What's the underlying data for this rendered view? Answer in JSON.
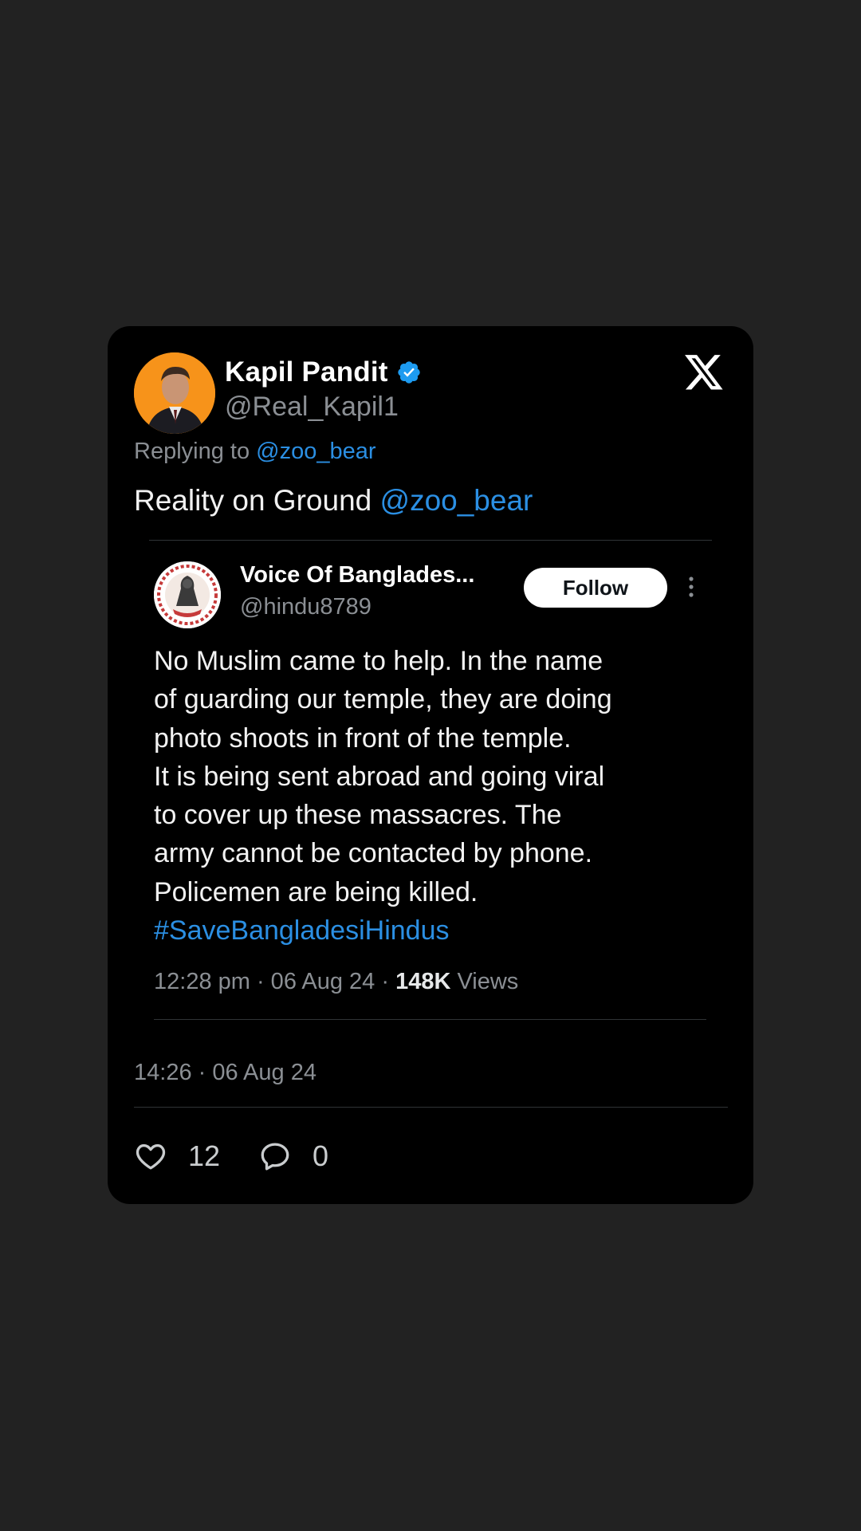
{
  "tweet": {
    "author": {
      "name": "Kapil Pandit",
      "handle": "@Real_Kapil1",
      "verified": true,
      "verified_color": "#1d9bf0",
      "avatar_bg": "#f7931a"
    },
    "platform_logo": "x-logo",
    "replying_to_prefix": "Replying to",
    "replying_to_handle": "@zoo_bear",
    "text_main": "Reality on Ground",
    "text_mention": "@zoo_bear",
    "timestamp": "14:26 · 06 Aug 24",
    "likes": "12",
    "replies": "0"
  },
  "quoted": {
    "name": "Voice Of Banglades...",
    "handle": "@hindu8789",
    "follow_label": "Follow",
    "body_lines": [
      "No Muslim came to help. In the name",
      "of guarding our temple, they are doing",
      "photo shoots in front of the temple.",
      "It is being sent abroad and going viral",
      "to cover up these massacres. The",
      "army cannot be contacted by phone.",
      "Policemen are being killed."
    ],
    "hashtag": "#SaveBangladesiHindus",
    "time": "12:28 pm · 06 Aug 24 · ",
    "views_count": "148K",
    "views_label": " Views"
  },
  "colors": {
    "page_bg": "#222222",
    "card_bg": "#000000",
    "link": "#2b8fe3",
    "muted": "#8b8f94"
  }
}
